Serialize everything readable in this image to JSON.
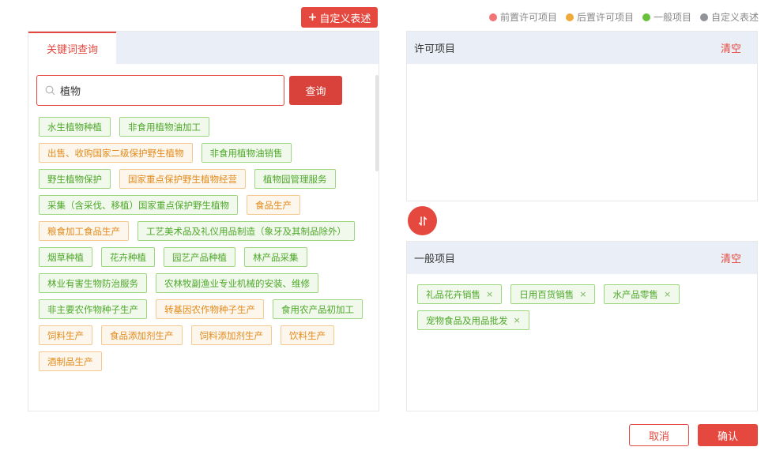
{
  "custom_button": {
    "plus": "+",
    "label": "自定义表述"
  },
  "legend": [
    {
      "label": "前置许可项目",
      "color": "#f27474"
    },
    {
      "label": "后置许可项目",
      "color": "#f0a93b"
    },
    {
      "label": "一般项目",
      "color": "#67c23a"
    },
    {
      "label": "自定义表述",
      "color": "#909399"
    }
  ],
  "left_panel": {
    "tab_label": "关键词查询",
    "search_value": "植物",
    "query_label": "查询",
    "tags": [
      {
        "label": "水生植物种植",
        "type": "general"
      },
      {
        "label": "非食用植物油加工",
        "type": "general"
      },
      {
        "label": "出售、收购国家二级保护野生植物",
        "type": "post"
      },
      {
        "label": "非食用植物油销售",
        "type": "general"
      },
      {
        "label": "野生植物保护",
        "type": "general"
      },
      {
        "label": "国家重点保护野生植物经营",
        "type": "post"
      },
      {
        "label": "植物园管理服务",
        "type": "general"
      },
      {
        "label": "采集（含采伐、移植）国家重点保护野生植物",
        "type": "general"
      },
      {
        "label": "食品生产",
        "type": "post"
      },
      {
        "label": "粮食加工食品生产",
        "type": "post"
      },
      {
        "label": "工艺美术品及礼仪用品制造（象牙及其制品除外）",
        "type": "general"
      },
      {
        "label": "烟草种植",
        "type": "general"
      },
      {
        "label": "花卉种植",
        "type": "general"
      },
      {
        "label": "园艺产品种植",
        "type": "general"
      },
      {
        "label": "林产品采集",
        "type": "general"
      },
      {
        "label": "林业有害生物防治服务",
        "type": "general"
      },
      {
        "label": "农林牧副渔业专业机械的安装、维修",
        "type": "general"
      },
      {
        "label": "非主要农作物种子生产",
        "type": "general"
      },
      {
        "label": "转基因农作物种子生产",
        "type": "post"
      },
      {
        "label": "食用农产品初加工",
        "type": "general"
      },
      {
        "label": "饲料生产",
        "type": "post"
      },
      {
        "label": "食品添加剂生产",
        "type": "post"
      },
      {
        "label": "饲料添加剂生产",
        "type": "post"
      },
      {
        "label": "饮料生产",
        "type": "post"
      },
      {
        "label": "酒制品生产",
        "type": "post"
      }
    ]
  },
  "permit_box": {
    "title": "许可项目",
    "clear_label": "清空"
  },
  "general_box": {
    "title": "一般项目",
    "clear_label": "清空",
    "selected": [
      {
        "label": "礼品花卉销售",
        "remove": "×"
      },
      {
        "label": "日用百货销售",
        "remove": "×"
      },
      {
        "label": "水产品零售",
        "remove": "×"
      },
      {
        "label": "宠物食品及用品批发",
        "remove": "×"
      }
    ]
  },
  "footer": {
    "cancel_label": "取消",
    "confirm_label": "确认"
  }
}
